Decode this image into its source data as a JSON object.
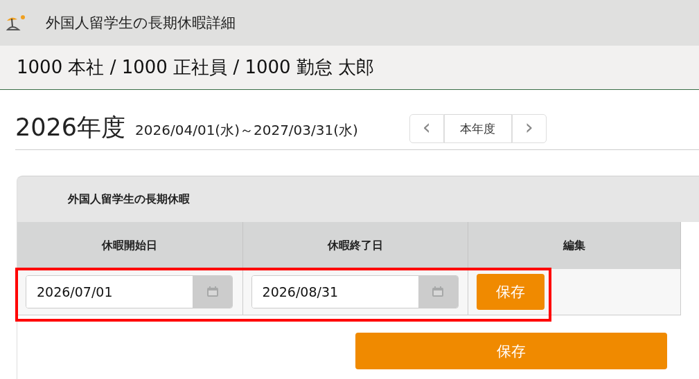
{
  "window": {
    "title": "外国人留学生の長期休暇詳細"
  },
  "breadcrumb": "1000 本社 / 1000 正社員 / 1000 勤怠 太郎",
  "fiscal_year": {
    "year": "2026年度",
    "range": "2026/04/01(水)～2027/03/31(水)",
    "prev": "‹",
    "current": "本年度",
    "next": "›"
  },
  "panel": {
    "title": "外国人留学生の長期休暇",
    "table": {
      "columns": [
        "休暇開始日",
        "休暇終了日",
        "編集"
      ],
      "rows": [
        {
          "start": "2026/07/01",
          "end": "2026/08/31",
          "action": "保存",
          "highlighted": true
        }
      ]
    }
  },
  "save_button": "保存"
}
